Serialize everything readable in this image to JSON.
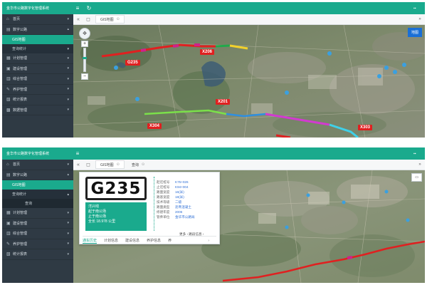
{
  "app": {
    "title": "金华市公路数字化管理系统"
  },
  "colors": {
    "accent": "#1aaa8d",
    "sidebar": "#2f3a44",
    "label_red": "#e02020"
  },
  "top": {
    "sidebar": [
      {
        "label": "首页",
        "icon": "home-icon",
        "caret": "▾"
      },
      {
        "label": "数字公路",
        "icon": "road-icon",
        "caret": "▴",
        "expanded": true
      },
      {
        "label": "GIS地图",
        "sub": true,
        "active": true
      },
      {
        "label": "查询统计",
        "sub": true,
        "caret": "▾"
      },
      {
        "label": "计划管理",
        "icon": "plan-icon",
        "caret": "▾"
      },
      {
        "label": "建设管理",
        "icon": "build-icon",
        "caret": "▾"
      },
      {
        "label": "综合管理",
        "icon": "manage-icon",
        "caret": "▾"
      },
      {
        "label": "养护管理",
        "icon": "maintain-icon",
        "caret": "▾"
      },
      {
        "label": "统计报表",
        "icon": "report-icon",
        "caret": "▾"
      },
      {
        "label": "数据管理",
        "icon": "data-icon",
        "caret": "▾"
      }
    ],
    "tab": "GIS地图",
    "map_type_label": "地图",
    "route_labels": [
      "G235",
      "X206",
      "X201",
      "X304",
      "X303"
    ]
  },
  "bottom": {
    "sidebar": [
      {
        "label": "首页",
        "icon": "home-icon",
        "caret": "▾"
      },
      {
        "label": "数字公路",
        "icon": "road-icon",
        "caret": "▴",
        "expanded": true
      },
      {
        "label": "GIS地图",
        "sub": true,
        "active": true
      },
      {
        "label": "查询统计",
        "sub": true,
        "caret": "▴"
      },
      {
        "label": "查询",
        "deep": true
      },
      {
        "label": "计划管理",
        "icon": "plan-icon",
        "caret": "▾"
      },
      {
        "label": "建设管理",
        "icon": "build-icon",
        "caret": "▾"
      },
      {
        "label": "综合管理",
        "icon": "manage-icon",
        "caret": "▾"
      },
      {
        "label": "养护管理",
        "icon": "maintain-icon",
        "caret": "▾"
      },
      {
        "label": "统计报表",
        "icon": "report-icon",
        "caret": "▾"
      }
    ],
    "tabs": [
      "GIS地图",
      "查询"
    ],
    "card": {
      "plate": "G235",
      "green_lines": [
        "洋兴线",
        "起于南公场",
        "止于南公场",
        "全长 18.978 公里"
      ],
      "details": [
        {
          "k": "起讫桩号",
          "v": "K75+026"
        },
        {
          "k": "止讫桩号",
          "v": "K94+004"
        },
        {
          "k": "路面宽度",
          "v": "16(米)"
        },
        {
          "k": "路基宽度",
          "v": "18(米)"
        },
        {
          "k": "技术等级",
          "v": "二级"
        },
        {
          "k": "路面类型",
          "v": "沥青混凝土"
        },
        {
          "k": "修建年度",
          "v": "2006"
        },
        {
          "k": "管养单位",
          "v": "金华市公路局"
        }
      ],
      "more": "更多 › 路段信息 ›",
      "tabs": [
        "通车历史",
        "计划信息",
        "建设信息",
        "养护信息",
        "养"
      ]
    }
  }
}
